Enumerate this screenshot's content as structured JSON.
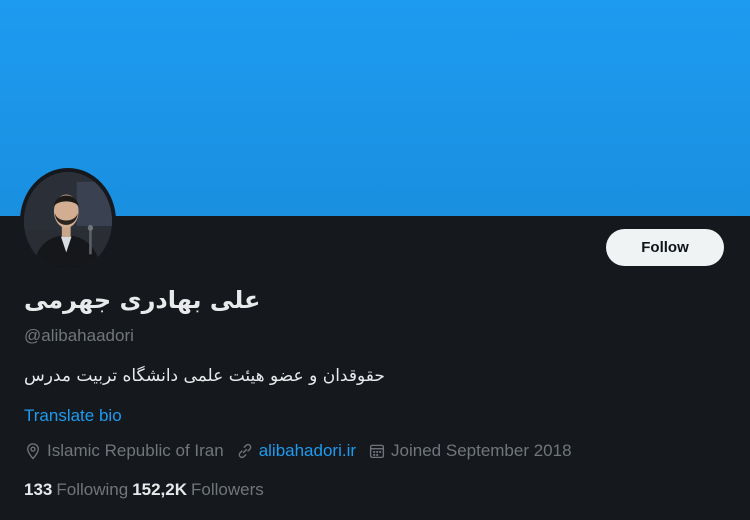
{
  "profile": {
    "display_name": "علی بهادری جهرمی",
    "handle": "@alibahaadori",
    "bio": "حقوقدان و عضو هیئت علمی دانشگاه تربیت مدرس",
    "translate_label": "Translate bio",
    "location": "Islamic Republic of Iran",
    "website": "alibahadori.ir",
    "joined": "Joined September 2018",
    "following_count": "133",
    "following_label": "Following",
    "followers_count": "152,2K",
    "followers_label": "Followers"
  },
  "actions": {
    "follow_label": "Follow"
  },
  "icons": {
    "location": "location-pin-icon",
    "website": "link-icon",
    "joined": "calendar-icon"
  },
  "colors": {
    "banner": "#1d9bf0",
    "background": "#15181c",
    "accent": "#1d9bf0",
    "text_primary": "#e7e9ea",
    "text_secondary": "#71767b",
    "follow_button_bg": "#eff3f4"
  }
}
